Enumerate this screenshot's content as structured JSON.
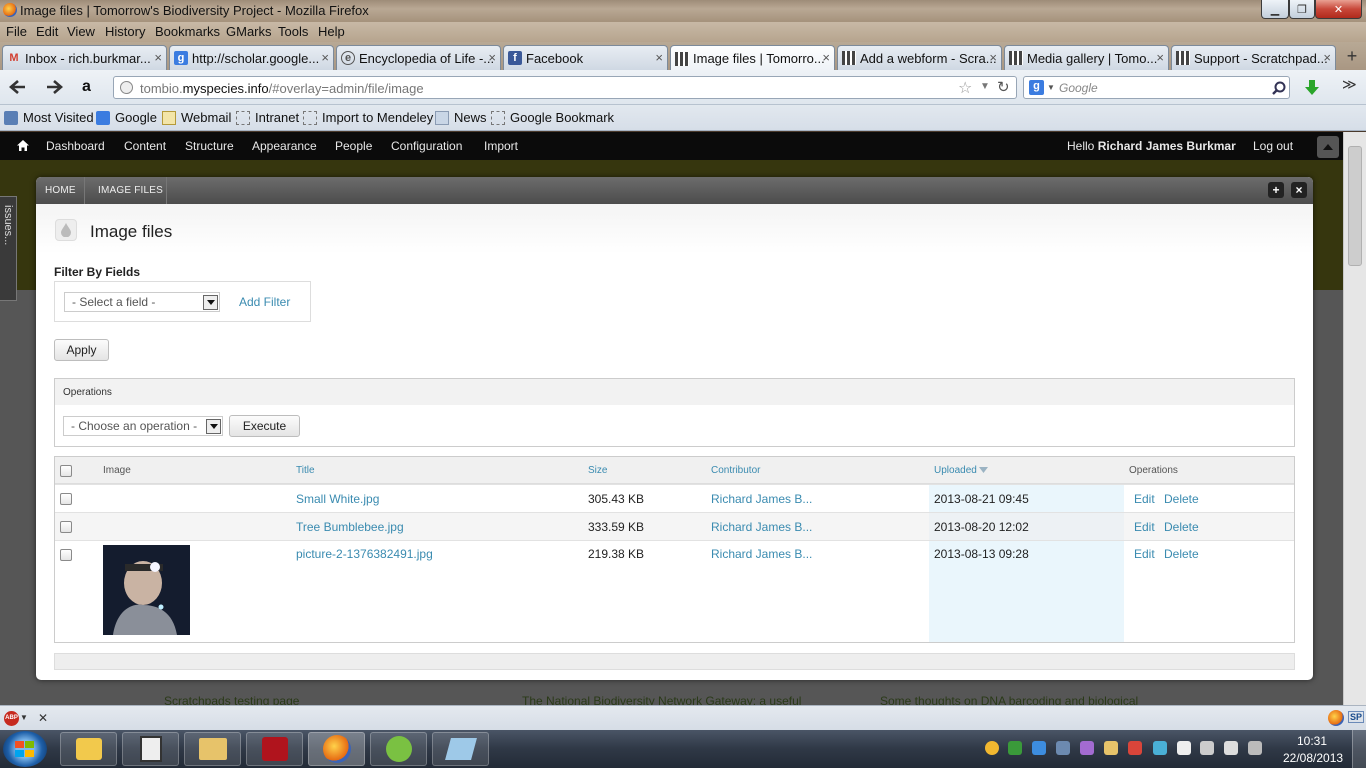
{
  "window": {
    "title": "Image files | Tomorrow's Biodiversity Project - Mozilla Firefox",
    "min_label": "▁",
    "max_label": "❐",
    "close_label": "✕"
  },
  "menu": [
    "File",
    "Edit",
    "View",
    "History",
    "Bookmarks",
    "GMarks",
    "Tools",
    "Help"
  ],
  "tabs": [
    {
      "label": "Inbox - rich.burkmar...",
      "icon": "gmail-icon"
    },
    {
      "label": "http://scholar.google...",
      "icon": "google-icon"
    },
    {
      "label": "Encyclopedia of Life -...",
      "icon": "eol-icon"
    },
    {
      "label": "Facebook",
      "icon": "facebook-icon"
    },
    {
      "label": "Image files | Tomorro...",
      "icon": "scratchpads-icon"
    },
    {
      "label": "Add a webform - Scra...",
      "icon": "scratchpads-icon"
    },
    {
      "label": "Media gallery | Tomo...",
      "icon": "scratchpads-icon"
    },
    {
      "label": "Support - Scratchpad...",
      "icon": "scratchpads-icon"
    }
  ],
  "tab_close": "×",
  "new_tab": "+",
  "nav": {
    "url_pre": "tombio.",
    "url_domain": "myspecies.info",
    "url_post": "/#overlay=admin/file/image",
    "search_placeholder": "Google"
  },
  "bookmarks": [
    "Most Visited",
    "Google",
    "Webmail",
    "Intranet",
    "Import to Mendeley",
    "News",
    "Google Bookmark"
  ],
  "toolbar": {
    "links": [
      "Dashboard",
      "Content",
      "Structure",
      "Appearance",
      "People",
      "Configuration",
      "Import"
    ],
    "hello": "Hello",
    "user": "Richard James Burkmar",
    "logout": "Log out"
  },
  "side_tab": "issues...",
  "background_links": [
    "Scratchpads testing page",
    "The National Biodiversity Network Gateway: a useful",
    "Some thoughts on DNA barcoding and biological"
  ],
  "overlay": {
    "breadcrumbs": [
      "HOME",
      "IMAGE FILES"
    ],
    "add_label": "+",
    "close_label": "×",
    "title": "Image files",
    "filter_heading": "Filter By Fields",
    "filter_select": "- Select a field -",
    "add_filter": "Add Filter",
    "apply": "Apply",
    "operations_heading": "Operations",
    "operation_select": "- Choose an operation -",
    "execute": "Execute"
  },
  "table": {
    "headers": [
      "Image",
      "Title",
      "Size",
      "Contributor",
      "Uploaded",
      "Operations"
    ],
    "rows": [
      {
        "title": "Small White.jpg",
        "size": "305.43 KB",
        "contributor": "Richard James B...",
        "uploaded": "2013-08-21 09:45",
        "edit": "Edit",
        "delete": "Delete",
        "has_thumb": false
      },
      {
        "title": "Tree Bumblebee.jpg",
        "size": "333.59 KB",
        "contributor": "Richard James B...",
        "uploaded": "2013-08-20 12:02",
        "edit": "Edit",
        "delete": "Delete",
        "has_thumb": false
      },
      {
        "title": "picture-2-1376382491.jpg",
        "size": "219.38 KB",
        "contributor": "Richard James B...",
        "uploaded": "2013-08-13 09:28",
        "edit": "Edit",
        "delete": "Delete",
        "has_thumb": true
      }
    ]
  },
  "clock": {
    "time": "10:31",
    "date": "22/08/2013"
  },
  "status": {
    "abp": "ABP",
    "close": "✕",
    "sp": "SP"
  }
}
